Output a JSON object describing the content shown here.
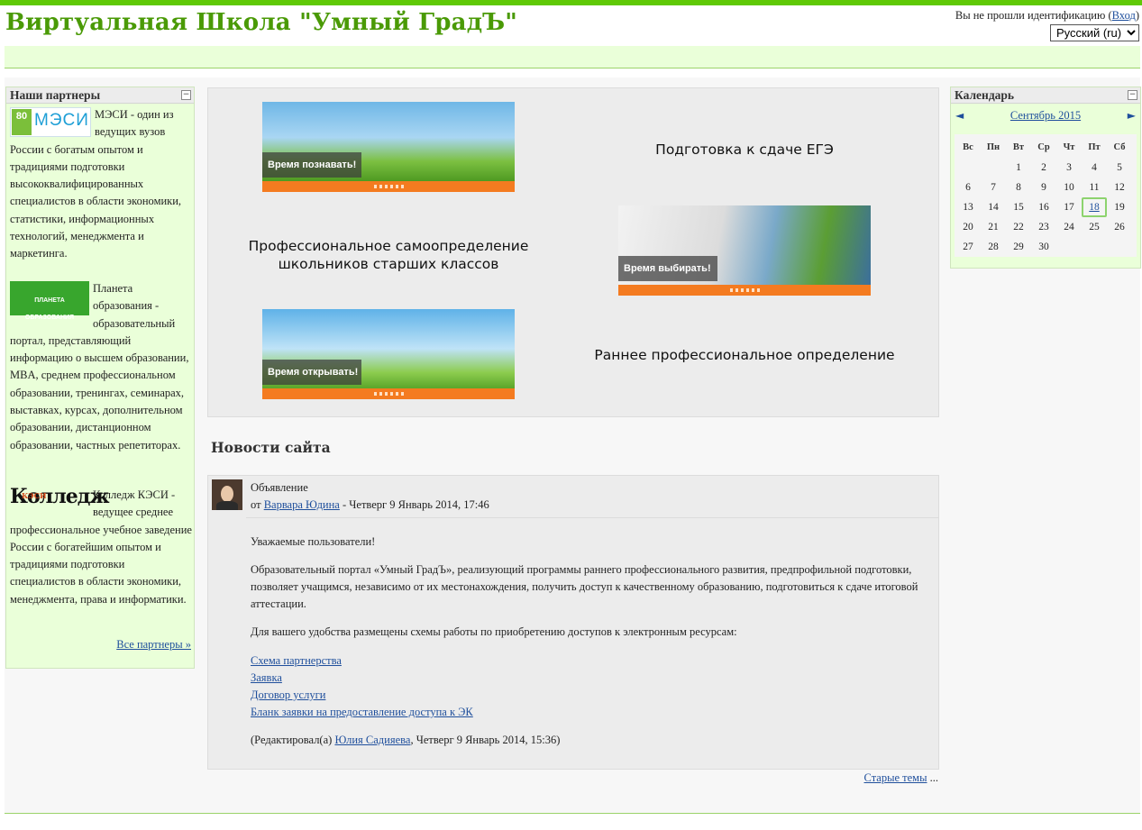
{
  "site": {
    "title": "Виртуальная Школа \"Умный ГрадЪ\"",
    "login_prefix": "Вы не прошли идентификацию (",
    "login_link": "Вход",
    "login_suffix": ")",
    "language": "Русский (ru)"
  },
  "partners": {
    "title": "Наши партнеры",
    "items": [
      {
        "logo_text": "МЭСИ",
        "logo_badge": "80",
        "text": "МЭСИ - один из ведущих вузов России с богатым опытом и традициями подготовки высококвалифицированных специалистов в области экономики, статистики, информационных технологий, менеджмента и маркетинга."
      },
      {
        "logo_text": "ПЛАНЕТА ОБРАЗОВАНИЯ",
        "text": "Планета образования - образовательный портал, представляющий информацию о высшем образовании, MBA, среднем профессиональном образовании, тренингах, семинарах, выставках, курсах, дополнительном образовании, дистанционном образовании, частных репетиторах."
      },
      {
        "logo_text": "Колледж",
        "logo_small": "КЭСИ",
        "text": "Колледж КЭСИ - ведущее среднее профессиональное учебное заведение России с богатейшим опытом и традициями подготовки специалистов в области экономики, менеджмента, права и информатики."
      }
    ],
    "all_link": "Все партнеры »"
  },
  "calendar": {
    "title": "Календарь",
    "month": "Сентябрь 2015",
    "prev": "◄",
    "next": "►",
    "weekdays": [
      "Вс",
      "Пн",
      "Вт",
      "Ср",
      "Чт",
      "Пт",
      "Сб"
    ],
    "first_weekday_index": 2,
    "days_in_month": 30,
    "today": 18
  },
  "promo": {
    "banners": [
      {
        "caption": "Время познавать!"
      },
      {
        "caption": "Время выбирать!"
      },
      {
        "caption": "Время открывать!"
      }
    ],
    "texts": [
      "Подготовка к сдаче ЕГЭ",
      "Профессиональное самоопределение школьников старших классов",
      "Раннее профессиональное определение"
    ]
  },
  "news": {
    "title": "Новости сайта",
    "post": {
      "subject": "Объявление",
      "by_prefix": "от ",
      "author": "Варвара Юдина",
      "date": " - Четверг 9 Январь 2014, 17:46",
      "greeting": "Уважаемые пользователи!",
      "paragraph": "Образовательный портал «Умный ГрадЪ», реализующий программы раннего профессионального развития, предпрофильной подготовки, позволяет учащимся, независимо от их местонахождения, получить доступ к качественному образованию, подготовиться к сдаче итоговой аттестации.",
      "schemes_intro": "Для вашего удобства размещены схемы работы по приобретению доступов к электронным ресурсам:",
      "links": [
        "Схема партнерства",
        "Заявка",
        "Договор услуги",
        "Бланк заявки на предоставление доступа к ЭК"
      ],
      "edited_prefix": "(Редактировал(а) ",
      "edited_by": "Юлия Садияева",
      "edited_suffix": ", Четверг 9 Январь 2014, 15:36)"
    },
    "older_link": "Старые темы",
    "older_suffix": " ..."
  }
}
